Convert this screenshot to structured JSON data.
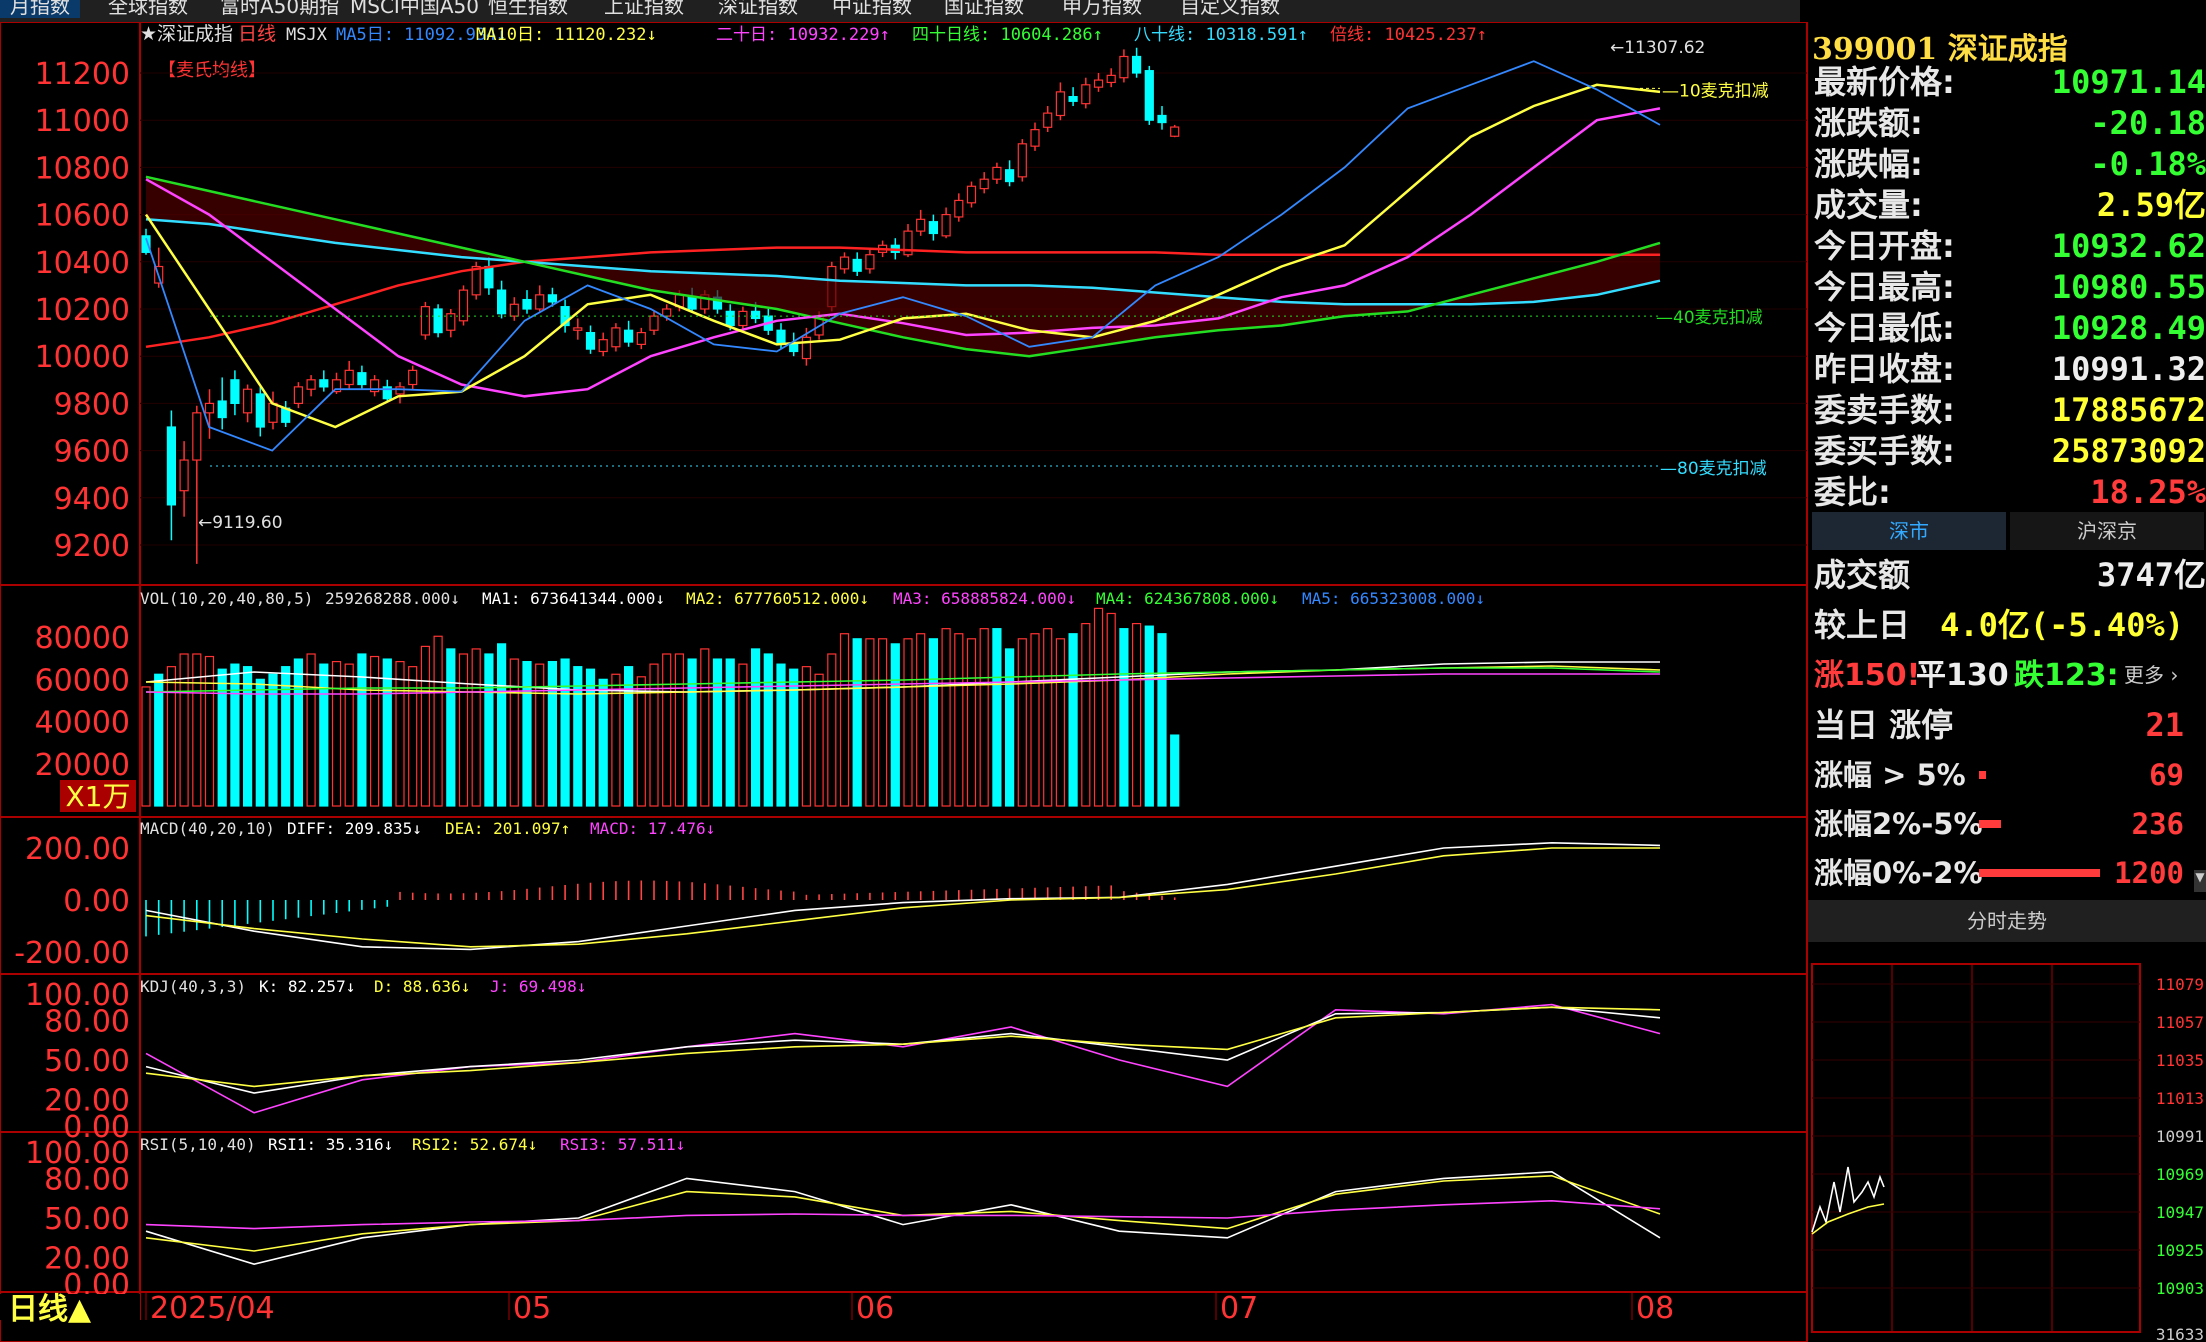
{
  "tabs": [
    "月指数",
    "全球指数",
    "富时A50期指",
    "MSCI中国A50",
    "恒生指数",
    "上证指数",
    "深证指数",
    "中证指数",
    "国证指数",
    "申万指数",
    "自定义指数"
  ],
  "chart_header": {
    "star_title": "★深证成指",
    "period": "日线",
    "indicator": "MSJX",
    "ma5": "MA5日: 11092.934↓",
    "ma10": "MA10日: 11120.232↓",
    "ma20": "二十日: 10932.229↑",
    "ma40": "四十日线: 10604.286↑",
    "ma80": "八十线: 10318.591↑",
    "bei": "倍线: 10425.237↑",
    "formula_tag": "【麦氏均线】"
  },
  "price_axis": [
    "11200",
    "11000",
    "10800",
    "10600",
    "10400",
    "10200",
    "10000",
    "9800",
    "9600",
    "9400",
    "9200"
  ],
  "annotations": {
    "high": "11307.62",
    "low": "9119.60",
    "deduct10": "10麦克扣减",
    "deduct40": "40麦克扣减",
    "deduct80": "80麦克扣减"
  },
  "vol_header": {
    "title": "VOL(10,20,40,80,5)",
    "vol": "259268288.000↓",
    "ma1": "MA1: 673641344.000↓",
    "ma2": "MA2: 677760512.000↓",
    "ma3": "MA3: 658885824.000↓",
    "ma4": "MA4: 624367808.000↓",
    "ma5": "MA5: 665323008.000↓"
  },
  "vol_axis": [
    "80000",
    "60000",
    "40000",
    "20000"
  ],
  "vol_unit": "X1万",
  "macd_header": {
    "title": "MACD(40,20,10)",
    "diff": "DIFF: 209.835↓",
    "dea": "DEA: 201.097↑",
    "macd": "MACD: 17.476↓"
  },
  "macd_axis": [
    "200.00",
    "0.00",
    "-200.00"
  ],
  "kdj_header": {
    "title": "KDJ(40,3,3)",
    "k": "K: 82.257↓",
    "d": "D: 88.636↓",
    "j": "J: 69.498↓"
  },
  "kdj_axis": [
    "100.00",
    "80.00",
    "50.00",
    "20.00",
    "0.00"
  ],
  "rsi_header": {
    "title": "RSI(5,10,40)",
    "rsi1": "RSI1: 35.316↓",
    "rsi2": "RSI2: 52.674↓",
    "rsi3": "RSI3: 57.511↓"
  },
  "rsi_axis": [
    "100.00",
    "80.00",
    "50.00",
    "20.00",
    "0.00"
  ],
  "date_axis": [
    "2025/04",
    "05",
    "06",
    "07",
    "08"
  ],
  "period_button": "日线▲",
  "quote": {
    "code_name": "399001 深证成指",
    "rows": [
      {
        "label": "最新价格:",
        "value": "10971.14",
        "color": "green"
      },
      {
        "label": "涨跌额:",
        "value": "-20.18",
        "color": "green"
      },
      {
        "label": "涨跌幅:",
        "value": "-0.18%",
        "color": "green"
      },
      {
        "label": "成交量:",
        "value": "2.59亿",
        "color": "yel"
      },
      {
        "label": "今日开盘:",
        "value": "10932.62",
        "color": "green"
      },
      {
        "label": "今日最高:",
        "value": "10980.55",
        "color": "green"
      },
      {
        "label": "今日最低:",
        "value": "10928.49",
        "color": "green"
      },
      {
        "label": "昨日收盘:",
        "value": "10991.32",
        "color": "white"
      },
      {
        "label": "委卖手数:",
        "value": "17885672",
        "color": "yel"
      },
      {
        "label": "委买手数:",
        "value": "25873092",
        "color": "yel"
      },
      {
        "label": "委比:",
        "value": "18.25%",
        "color": "red"
      }
    ],
    "market_tabs": [
      "深市",
      "沪深京"
    ],
    "turnover_label": "成交额",
    "turnover_value": "3747亿",
    "compare_label": "较上日",
    "compare_value": "4.0亿(-5.40%)",
    "breadth": {
      "up": "涨150!",
      "flat": "平130",
      "down": "跌123:",
      "more": "更多 ›"
    },
    "limit_label": "当日 涨停",
    "limit_value": "21",
    "dist": [
      {
        "label": "涨幅 > 5%",
        "value": "69",
        "bar": 0.03
      },
      {
        "label": "涨幅2%-5%",
        "value": "236",
        "bar": 0.1
      },
      {
        "label": "涨幅0%-2%",
        "value": "1200",
        "bar": 0.55
      }
    ],
    "intraday_title": "分时走势",
    "intraday_axis": [
      "11079",
      "11057",
      "11035",
      "11013",
      "10991",
      "10969",
      "10947",
      "10925",
      "10903"
    ],
    "intraday_vol": "31633"
  }
}
